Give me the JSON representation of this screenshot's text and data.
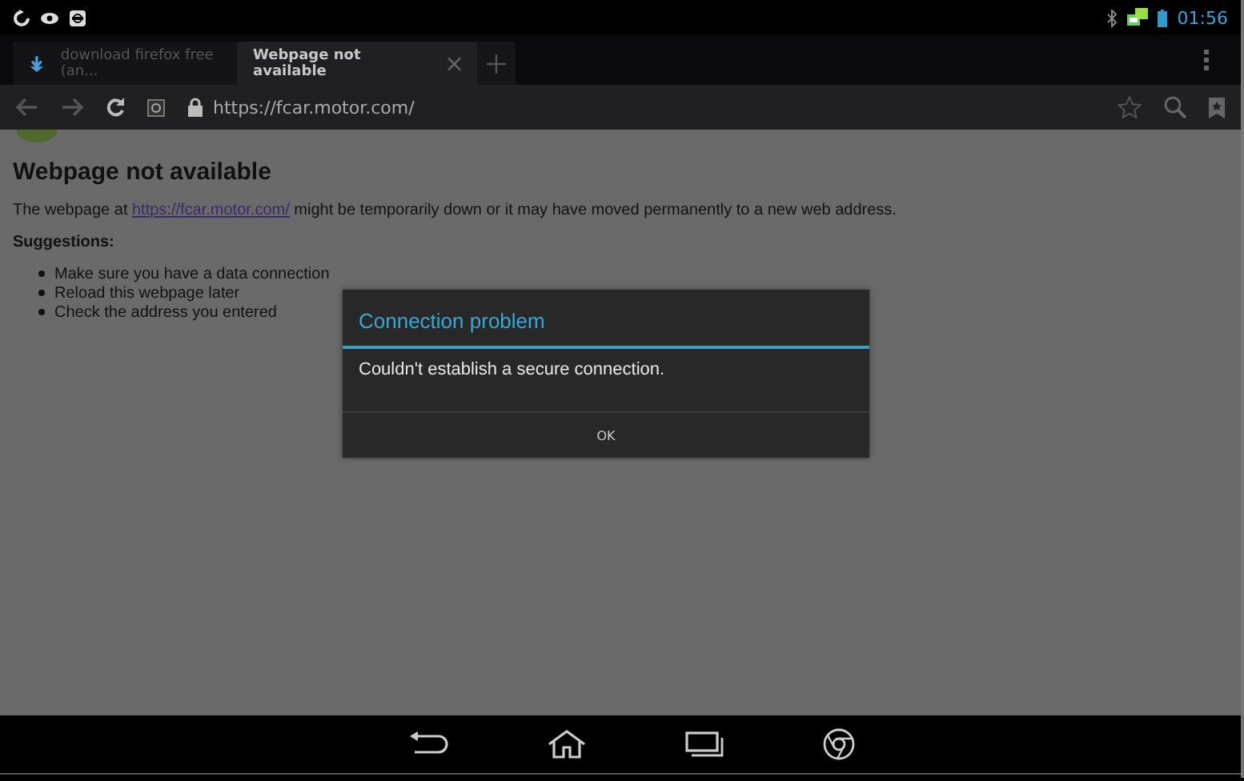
{
  "status_bar": {
    "time": "01:56"
  },
  "tabs": [
    {
      "label": "download firefox free (an...",
      "selected": false
    },
    {
      "label": "Webpage not available",
      "selected": true
    }
  ],
  "address_bar": {
    "url": "https://fcar.motor.com/"
  },
  "page": {
    "heading": "Webpage not available",
    "intro_before": "The webpage at ",
    "intro_link": "https://fcar.motor.com/",
    "intro_after": " might be temporarily down or it may have moved permanently to a new web address.",
    "suggestions_heading": "Suggestions:",
    "suggestions": [
      "Make sure you have a data connection",
      "Reload this webpage later",
      "Check the address you entered"
    ]
  },
  "dialog": {
    "title": "Connection problem",
    "message": "Couldn't establish a secure connection.",
    "buttons": [
      "OK"
    ]
  }
}
